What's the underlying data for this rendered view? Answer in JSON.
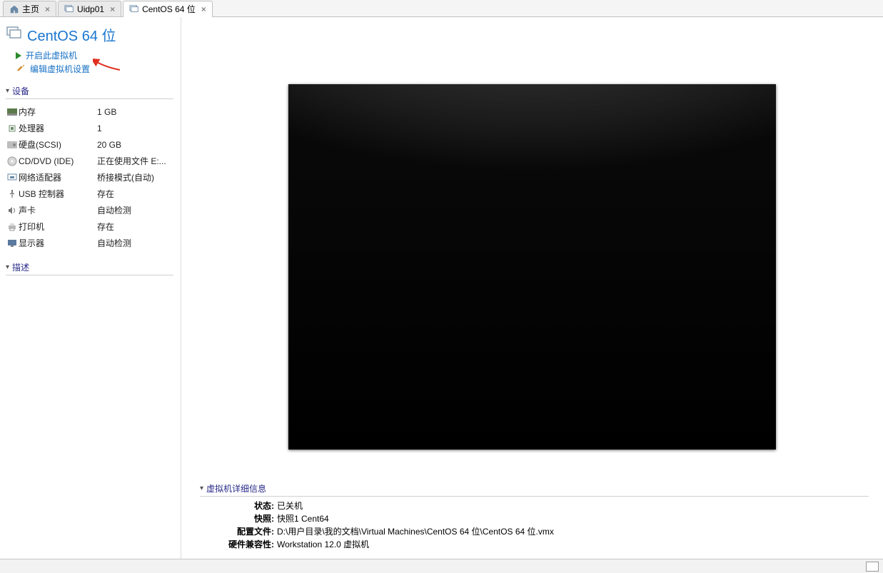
{
  "tabs": [
    {
      "label": "主页",
      "icon": "home",
      "closable": true,
      "active": false
    },
    {
      "label": "Uidp01",
      "icon": "monitor",
      "closable": true,
      "active": false
    },
    {
      "label": "CentOS 64 位",
      "icon": "monitor",
      "closable": true,
      "active": true
    }
  ],
  "vm": {
    "title": "CentOS 64 位"
  },
  "actions": {
    "power_on": "开启此虚拟机",
    "edit": "编辑虚拟机设置"
  },
  "sections": {
    "devices": "设备",
    "description": "描述",
    "details": "虚拟机详细信息"
  },
  "devices": [
    {
      "icon": "memory",
      "label": "内存",
      "value": "1 GB"
    },
    {
      "icon": "cpu",
      "label": "处理器",
      "value": "1"
    },
    {
      "icon": "disk",
      "label": "硬盘(SCSI)",
      "value": "20 GB"
    },
    {
      "icon": "cd",
      "label": "CD/DVD (IDE)",
      "value": "正在使用文件 E:..."
    },
    {
      "icon": "net",
      "label": "网络适配器",
      "value": "桥接模式(自动)"
    },
    {
      "icon": "usb",
      "label": "USB 控制器",
      "value": "存在"
    },
    {
      "icon": "sound",
      "label": "声卡",
      "value": "自动检测"
    },
    {
      "icon": "printer",
      "label": "打印机",
      "value": "存在"
    },
    {
      "icon": "display",
      "label": "显示器",
      "value": "自动检测"
    }
  ],
  "details": {
    "state_label": "状态:",
    "state": "已关机",
    "snapshot_label": "快照:",
    "snapshot": "快照1 Cent64",
    "config_label": "配置文件:",
    "config": "D:\\用户目录\\我的文档\\Virtual Machines\\CentOS 64 位\\CentOS 64 位.vmx",
    "hwcompat_label": "硬件兼容性:",
    "hwcompat": "Workstation 12.0 虚拟机"
  }
}
